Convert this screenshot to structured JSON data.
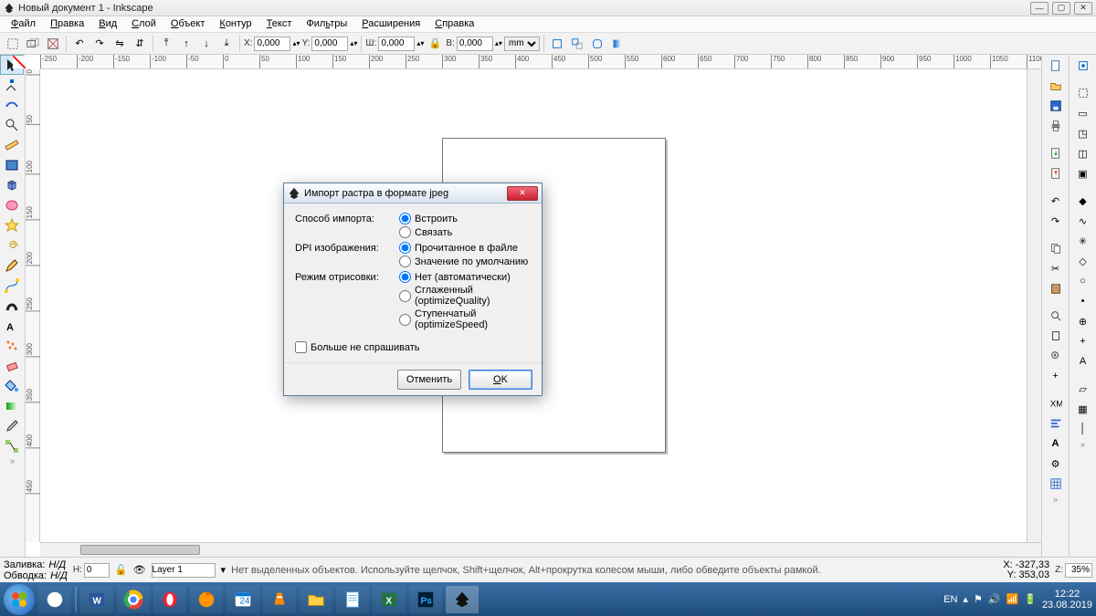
{
  "window": {
    "title": "Новый документ 1 - Inkscape"
  },
  "menu": {
    "file": "Файл",
    "edit": "Правка",
    "view": "Вид",
    "layer": "Слой",
    "object": "Объект",
    "path": "Контур",
    "text": "Текст",
    "filters": "Фильтры",
    "extensions": "Расширения",
    "help": "Справка"
  },
  "toolbar": {
    "x_label": "X:",
    "x": "0,000",
    "y_label": "Y:",
    "y": "0,000",
    "w_label": "Ш:",
    "w": "0,000",
    "h_label": "В:",
    "h": "0,000",
    "unit": "mm",
    "lock": "⚿"
  },
  "dialog": {
    "title": "Импорт растра в формате jpeg",
    "import_mode_label": "Способ импорта:",
    "import_embed": "Встроить",
    "import_link": "Связать",
    "dpi_label": "DPI изображения:",
    "dpi_file": "Прочитанное в файле",
    "dpi_default": "Значение по умолчанию",
    "render_label": "Режим отрисовки:",
    "render_none": "Нет (автоматически)",
    "render_quality": "Сглаженный (optimizeQuality)",
    "render_speed": "Ступенчатый (optimizeSpeed)",
    "dont_ask": "Больше не спрашивать",
    "cancel": "Отменить",
    "ok": "OK"
  },
  "status": {
    "fill_label": "Заливка:",
    "fill_val": "Н/Д",
    "stroke_label": "Обводка:",
    "stroke_val": "Н/Д",
    "h_label": "Н:",
    "h_val": "0",
    "layer": "Layer 1",
    "hint": "Нет выделенных объектов. Используйте щелчок, Shift+щелчок, Alt+прокрутка колесом мыши, либо обведите объекты рамкой.",
    "x": "X: -327,33",
    "y": "Y:  353,03",
    "z_label": "Z:",
    "zoom": "35%"
  },
  "tray": {
    "lang": "EN",
    "time": "12:22",
    "date": "23.08.2019",
    "notif": "24"
  },
  "palette_colors": [
    "#000000",
    "#333333",
    "#4d4d4d",
    "#666666",
    "#808080",
    "#999999",
    "#b3b3b3",
    "#cccccc",
    "#e6e6e6",
    "#f2f2f2",
    "#ffffff",
    "#800000",
    "#a52a2a",
    "#ff0000",
    "#ff4500",
    "#ff8c00",
    "#ffa500",
    "#ffd700",
    "#ffff00",
    "#9acd32",
    "#00ff00",
    "#008000",
    "#006400",
    "#00fa9a",
    "#00ffff",
    "#40e0d0",
    "#1e90ff",
    "#0000ff",
    "#00008b",
    "#4b0082",
    "#8a2be2",
    "#9400d3",
    "#ff00ff",
    "#c71585",
    "#ff1493",
    "#ffc0cb",
    "#f5deb3",
    "#d2b48c",
    "#bc8f8f",
    "#cd853f",
    "#a0522d",
    "#8b4513",
    "#696969",
    "#2f4f4f",
    "#556b2f",
    "#6b8e23",
    "#808000",
    "#b8860b",
    "#daa520",
    "#e9967a",
    "#fa8072",
    "#f08080",
    "#ff6347",
    "#ff7f50",
    "#ffb6c1",
    "#dda0dd",
    "#da70d6",
    "#ba55d3",
    "#9370db",
    "#7b68ee",
    "#6a5acd",
    "#483d8b",
    "#4169e1",
    "#4682b4",
    "#5f9ea0",
    "#87ceeb",
    "#add8e6",
    "#b0e0e6",
    "#afeeee",
    "#e0ffff",
    "#f0fff0",
    "#fafad2",
    "#fffacd",
    "#fff8dc"
  ],
  "ruler_h": [
    "-250",
    "-200",
    "-150",
    "-100",
    "-50",
    "0",
    "50",
    "100",
    "150",
    "200",
    "250",
    "300",
    "350",
    "400",
    "450",
    "500",
    "550",
    "600",
    "650",
    "700",
    "750",
    "800",
    "850",
    "900",
    "950",
    "1000",
    "1050",
    "1100"
  ],
  "ruler_v": [
    "0",
    "50",
    "100",
    "150",
    "200",
    "250",
    "300",
    "350",
    "400",
    "450"
  ]
}
